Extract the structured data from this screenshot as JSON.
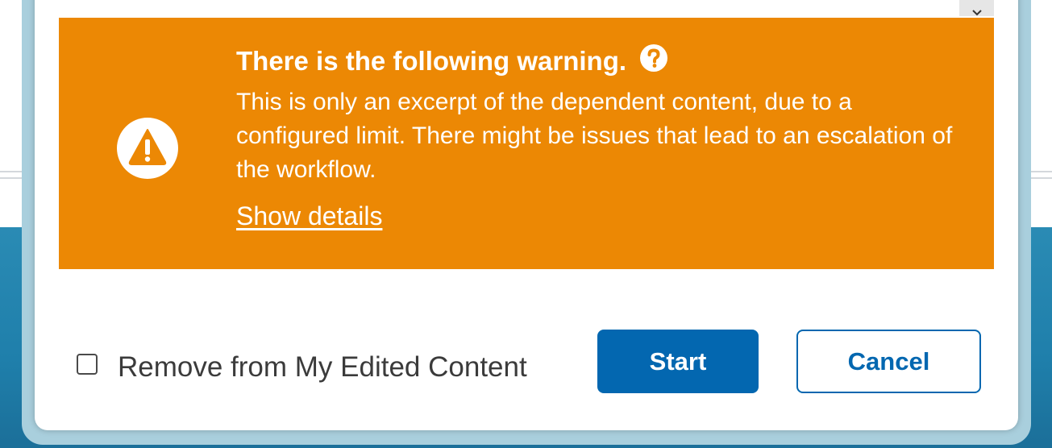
{
  "warning": {
    "title": "There is the following warning.",
    "message": "This is only an excerpt of the dependent content, due to a configured limit. There might be issues that lead to an escalation of the workflow.",
    "show_details_label": "Show details",
    "icon": "warning-triangle-icon",
    "help_icon": "question-circle-icon",
    "background_color": "#ec8804"
  },
  "footer": {
    "checkbox_label": "Remove from My Edited Content",
    "checkbox_checked": false,
    "start_label": "Start",
    "cancel_label": "Cancel",
    "primary_color": "#0367b0"
  }
}
